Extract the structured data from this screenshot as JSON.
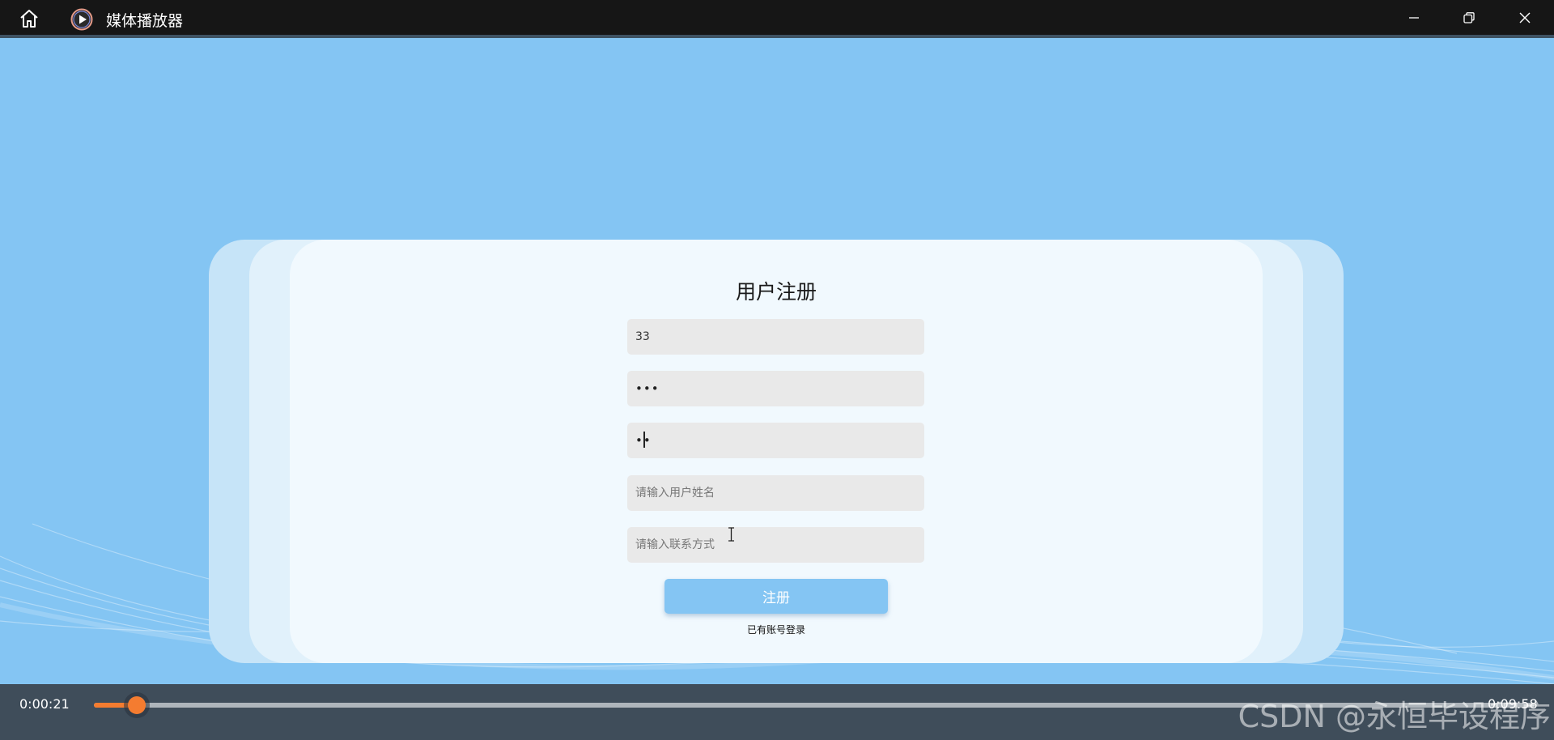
{
  "window": {
    "title": "媒体播放器",
    "icons": {
      "home": "home-icon",
      "app": "play-icon",
      "minimize": "minimize-icon",
      "restore": "restore-icon",
      "close": "close-icon"
    }
  },
  "form": {
    "title": "用户注册",
    "username_value": "33",
    "password_value": "123",
    "confirm_value": "12",
    "name_placeholder": "请输入用户姓名",
    "contact_placeholder": "请输入联系方式",
    "submit_label": "注册",
    "login_link": "已有账号登录"
  },
  "player": {
    "current_time": "0:00:21",
    "total_time": "0:09:58",
    "progress": 0.03,
    "accent": "#f47c30"
  },
  "watermark": "CSDN @永恒毕设程序",
  "colors": {
    "background": "#84c5f3",
    "titlebar": "#161616",
    "card": "#f1f9fe",
    "field": "#e9e9e9",
    "button": "#84c5f3"
  }
}
